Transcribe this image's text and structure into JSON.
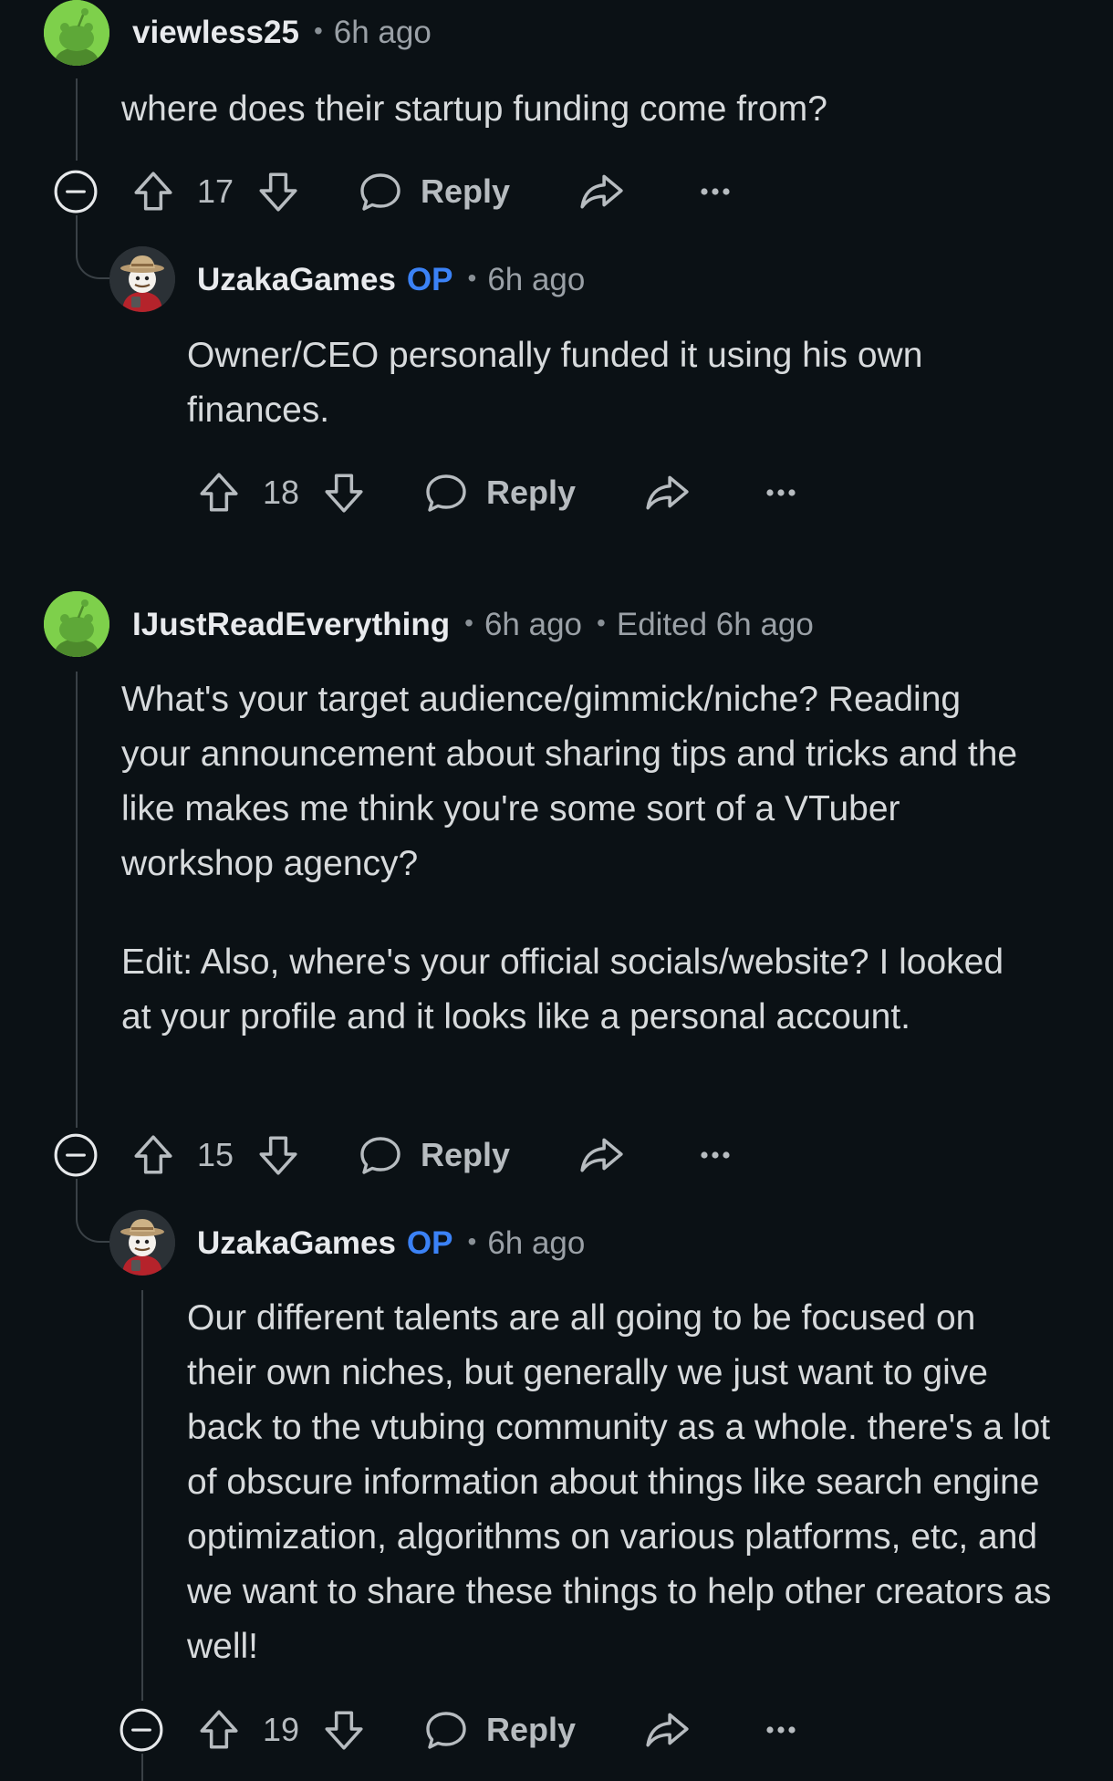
{
  "comments": [
    {
      "username": "viewless25",
      "op_badge": "",
      "time": "6h ago",
      "edited": "",
      "body": [
        "where does their startup funding come from?"
      ],
      "votes": "17",
      "reply_label": "Reply"
    },
    {
      "username": "UzakaGames",
      "op_badge": "OP",
      "time": "6h ago",
      "edited": "",
      "body": [
        "Owner/CEO personally funded it using his own finances."
      ],
      "votes": "18",
      "reply_label": "Reply"
    },
    {
      "username": "IJustReadEverything",
      "op_badge": "",
      "time": "6h ago",
      "edited": "Edited 6h ago",
      "body": [
        "What's your target audience/gimmick/niche? Reading your announcement about sharing tips and tricks and the like makes me think you're some sort of a VTuber workshop agency?",
        "Edit: Also, where's your official socials/website? I looked at your profile and it looks like a personal account."
      ],
      "votes": "15",
      "reply_label": "Reply"
    },
    {
      "username": "UzakaGames",
      "op_badge": "OP",
      "time": "6h ago",
      "edited": "",
      "body": [
        "Our different talents are all going to be focused on their own niches, but generally we just want to give back to the vtubing community as a whole. there's a lot of obscure information about things like search engine optimization, algorithms on various platforms, etc, and we want to share these things to help other creators as well!"
      ],
      "votes": "19",
      "reply_label": "Reply"
    }
  ],
  "colors": {
    "background": "#0b1115",
    "op_badge": "#3b82f6",
    "avatar_green": "#7ed04b"
  },
  "icons": [
    "collapse-icon",
    "upvote-icon",
    "downvote-icon",
    "comment-icon",
    "share-icon",
    "more-icon"
  ]
}
